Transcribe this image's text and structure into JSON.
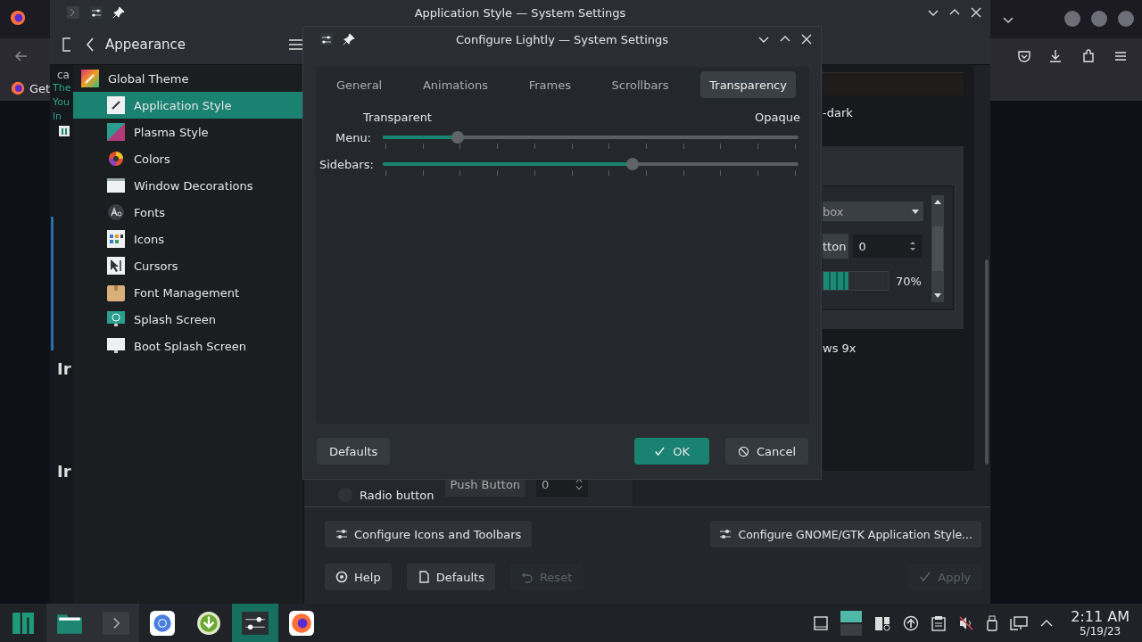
{
  "browser": {
    "bookmark": "Get"
  },
  "background_window": {
    "tab": "ca",
    "lines": [
      "The",
      "You",
      "ln"
    ],
    "headings": [
      "Ir",
      "Ir"
    ]
  },
  "settings_window": {
    "title": "Application Style — System Settings",
    "sidebar": {
      "title": "Appearance",
      "items": [
        {
          "label": "Global Theme",
          "selected": false,
          "children": [
            {
              "label": "Application Style",
              "selected": true
            },
            {
              "label": "Plasma Style",
              "selected": false
            },
            {
              "label": "Colors",
              "selected": false
            },
            {
              "label": "Window Decorations",
              "selected": false
            },
            {
              "label": "Fonts",
              "selected": false
            },
            {
              "label": "Icons",
              "selected": false
            },
            {
              "label": "Cursors",
              "selected": false
            },
            {
              "label": "Font Management",
              "selected": false
            },
            {
              "label": "Splash Screen",
              "selected": false
            },
            {
              "label": "Boot Splash Screen",
              "selected": false
            }
          ]
        }
      ]
    },
    "preview": {
      "theme_suffix": "-dark",
      "combo": "box",
      "button": "tton",
      "spin": "0",
      "progress": {
        "reading": "70%"
      },
      "style_name": "ws 9x",
      "radio": {
        "label": "Radio button",
        "checked": false
      },
      "push_button": "Push Button",
      "spin_2": "0"
    },
    "footer": {
      "configure_icons": "Configure Icons and Toolbars",
      "configure_gtk": "Configure GNOME/GTK Application Style...",
      "help": "Help",
      "defaults": "Defaults",
      "reset": {
        "label": "Reset",
        "disabled": true
      },
      "apply": {
        "label": "Apply",
        "disabled": true
      }
    }
  },
  "dialog": {
    "title": "Configure Lightly — System Settings",
    "tabs": [
      {
        "label": "General",
        "selected": false
      },
      {
        "label": "Animations",
        "selected": false
      },
      {
        "label": "Frames",
        "selected": false
      },
      {
        "label": "Scrollbars",
        "selected": false
      },
      {
        "label": "Transparency",
        "selected": true
      }
    ],
    "scale": {
      "min": "Transparent",
      "max": "Opaque"
    },
    "sliders": [
      {
        "label": "Menu:",
        "level": 0.18
      },
      {
        "label": "Sidebars:",
        "level": 0.6
      }
    ],
    "buttons": [
      {
        "label": "Defaults",
        "kind": "plain"
      },
      {
        "label": "OK",
        "kind": "primary"
      },
      {
        "label": "Cancel",
        "kind": "cancel"
      }
    ]
  },
  "taskbar": {
    "apps": [
      {
        "kind": "launcher",
        "active": false,
        "open": false
      },
      {
        "kind": "files",
        "active": false,
        "open": true
      },
      {
        "kind": "terminal",
        "active": false,
        "open": true
      },
      {
        "kind": "browser",
        "active": false,
        "open": false
      },
      {
        "kind": "download",
        "active": false,
        "open": false
      },
      {
        "kind": "settings",
        "active": true,
        "open": true
      },
      {
        "kind": "firefox",
        "active": false,
        "open": false
      }
    ],
    "clock": {
      "time": "2:11 AM",
      "date": "5/19/23"
    }
  }
}
